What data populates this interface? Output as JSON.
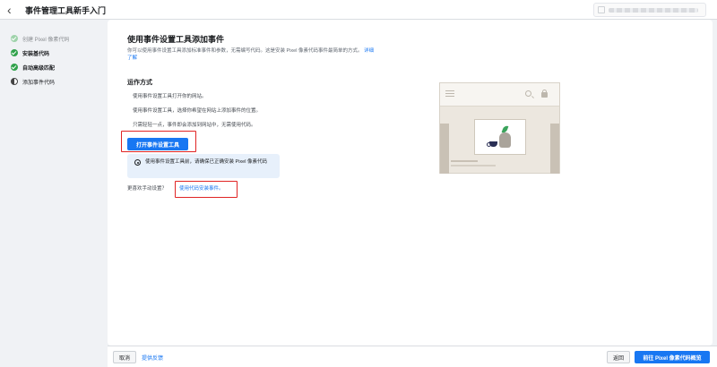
{
  "header": {
    "title": "事件管理工具新手入门",
    "back_icon": "chevron-left-icon"
  },
  "sidebar": {
    "steps": [
      {
        "label": "创建 Pixel 像素代码",
        "state": "done-light"
      },
      {
        "label": "安装基代码",
        "state": "done"
      },
      {
        "label": "自动高级匹配",
        "state": "done"
      },
      {
        "label": "添加事件代码",
        "state": "current"
      }
    ]
  },
  "main": {
    "title": "使用事件设置工具添加事件",
    "description": "你可以使用事件设置工具添加标准事件和参数，无需编写代码。这是安装 Pixel 像素代码事件最简单的方式。",
    "learn_more": "详细了解",
    "how_title": "运作方式",
    "steps": [
      "使用事件设置工具打开你的网站。",
      "使用事件设置工具，选择你希望在网站上添加事件的位置。",
      "只需轻轻一点，事件即会添加到网站中，无需使用代码。"
    ],
    "open_button": "打开事件设置工具",
    "info_text": "使用事件设置工具前，请确保已正确安装 Pixel 像素代码",
    "manual_prefix": "更喜欢手动设置？",
    "manual_link": "使用代码安装事件。"
  },
  "footer": {
    "cancel": "取消",
    "feedback": "提供反馈",
    "back": "返回",
    "next": "前往 Pixel 像素代码概览"
  },
  "colors": {
    "primary": "#1877f2",
    "success": "#31a24c",
    "highlight": "#e02424"
  }
}
